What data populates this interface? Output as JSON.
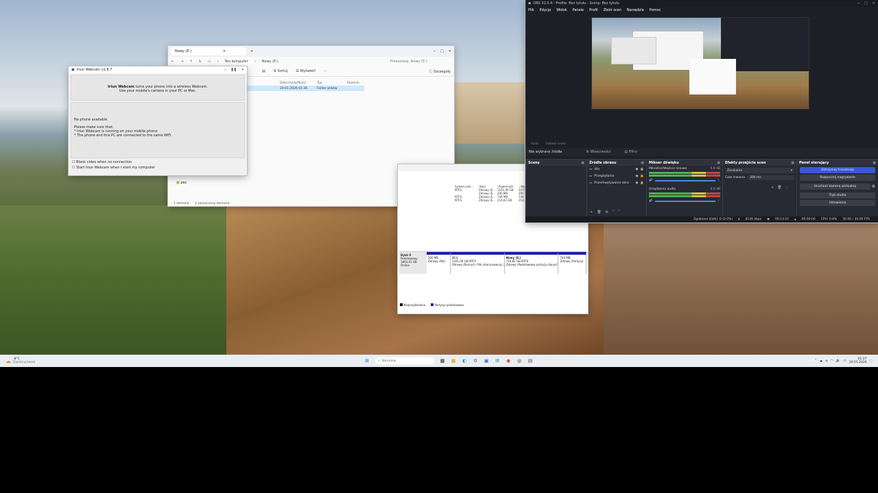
{
  "explorer": {
    "tab_title": "Nowy (E:)",
    "new_tab": "+",
    "breadcrumb_pc": "Ten komputer",
    "breadcrumb_drive": "Nowy (E:)",
    "search_placeholder": "Przeszukaj: Nowy (E:)",
    "sort_label": "Sortuj",
    "view_label": "Wyświetl",
    "more": "···",
    "details_label": "Szczegóły",
    "col_date": "Data modyfikacji",
    "col_type": "Typ",
    "col_size": "Rozmiar",
    "row_date": "20.01.2026 01:26",
    "row_type": "Folder plików",
    "side_item": "pac",
    "status_count": "1 element",
    "status_selected": "1 zaznaczony element"
  },
  "irium": {
    "title": "Iriun Webcam v2.8.7",
    "intro_bold": "Iriun Webcam",
    "intro_rest": " turns your phone into a wireless Webcam.",
    "intro_line2": "Use your mobile's camera in your PC or Mac.",
    "no_phone": "No phone available.",
    "make_sure": "Please make sure that:",
    "bullet1": "* Iriun Webcam is running on your mobile phone",
    "bullet2": "* The phone and this PC are connected to the same WiFi",
    "chk1": "Blank video when no connection",
    "chk2": "Start Iriun Webcam when I start my computer"
  },
  "diskmgmt": {
    "headers": [
      "System plik...",
      "Stan",
      "Pojemność",
      "Wolne ...",
      "% wolnego"
    ],
    "rows": [
      [
        "NTFS",
        "Zdrowy (E...",
        "1161,09 GB",
        "1071,91 ...",
        "92 %"
      ],
      [
        "",
        "Zdrowy (E...",
        "200 MB",
        "200 MB",
        "100 %"
      ],
      [
        "NTFS",
        "Zdrowy (E...",
        "744 MB",
        "744 MB",
        "100 %"
      ],
      [
        "NTFS",
        "Zdrowy (E...",
        "214,62 GB",
        "214,90 GB",
        "100 %"
      ]
    ],
    "disk_name": "Dysk 0",
    "disk_type": "Podstawowy",
    "disk_size": "1863,01 GB",
    "disk_status": "Online",
    "partitions": [
      {
        "name": "",
        "size": "200 MB",
        "status": "Zdrowy (Part"
      },
      {
        "name": "(C:)",
        "size": "1161,09 GB NTFS",
        "status": "Zdrowy (Rozruch, Plik stronicowania, Z"
      },
      {
        "name": "Nowy (E:)",
        "size": "716,82 GB NTFS",
        "status": "Zdrowy (Podstawowa partycja danych"
      },
      {
        "name": "",
        "size": "744 MB",
        "status": "Zdrowy (Partycja"
      }
    ],
    "legend1": "Nieprzydzielone",
    "legend2": "Partycja podstawowa"
  },
  "obs": {
    "title": "OBS 32.0.4 - Profile: Bez tytułu - Sceny: Bez tytułu",
    "menu": [
      "Plik",
      "Edycja",
      "Widok",
      "Panele",
      "Profil",
      "Zbiór scen",
      "Narzędzia",
      "Pomoc"
    ],
    "preview_bar1": "Audio",
    "preview_bar2": "Gdański scena",
    "no_source": "Nie wybrano źródła",
    "properties": "Właściwości",
    "filters": "Filtry",
    "scenes_title": "Sceny",
    "sources_title": "Źródła obrazu",
    "sources": [
      "dźn",
      "Przeglądarka",
      "Przechwytywanie ekra"
    ],
    "mixer_title": "Mikser dźwięku",
    "mixer_ch1": "Mikrofon/Wejście liniowe",
    "mixer_ch1_db": "0.0 dB",
    "mixer_ch2": "Urządzenia audio",
    "mixer_ch2_db": "0.0 dB",
    "transitions_title": "Efekty przejścia scen",
    "transition_value": "Zanikanie",
    "duration_label": "Czas trwania",
    "duration_value": "300 ms",
    "controls_title": "Panel sterujący",
    "btn_stream": "Zatrzymaj transmisję",
    "btn_record": "Rozpocznij nagrywanie",
    "btn_vcam": "Uruchom kamerę wirtualną",
    "btn_studio": "Tryb studia",
    "btn_settings": "Ustawienia",
    "status_dropped": "Zgubione klatki: 0 (0.0%)",
    "status_kbps": "8136 kbps",
    "status_live": "00:14:21",
    "status_rec": "00:00:00",
    "status_cpu": "CPU: 0.8%",
    "status_fps": "30.00 / 30.00 FPS"
  },
  "taskbar": {
    "weather_temp": "-8°C",
    "weather_desc": "Zachmurzenie",
    "search_placeholder": "Wyszukaj",
    "time": "01:27",
    "date": "20.01.2026"
  }
}
